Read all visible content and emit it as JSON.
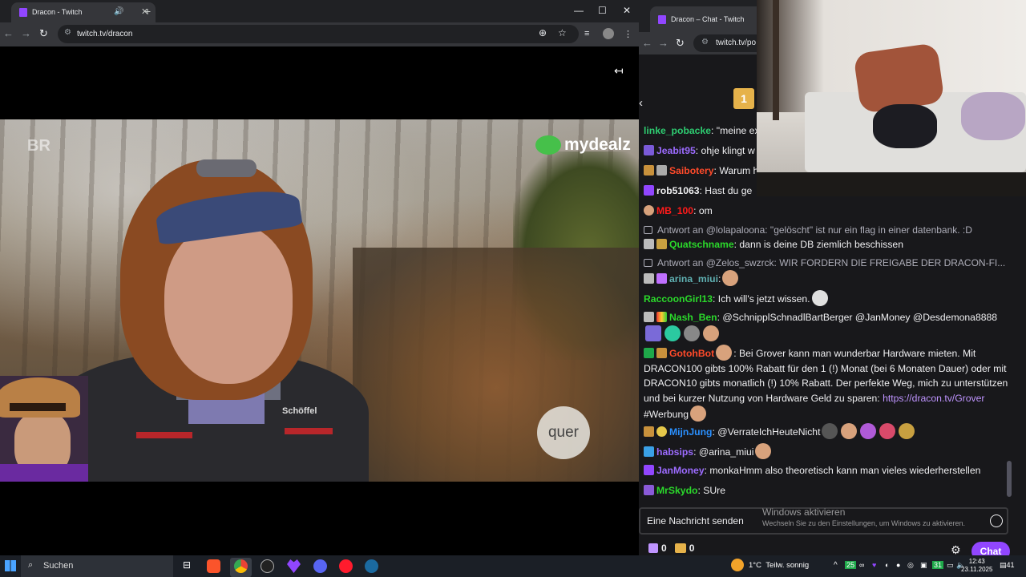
{
  "left_browser": {
    "tab_title": "Dracon - Twitch",
    "url": "twitch.tv/dracon",
    "new_tab": "+",
    "minimize": "—",
    "maximize": "☐",
    "close": "✕"
  },
  "video": {
    "br_logo": "BR",
    "sponsor_logo": "mydealz",
    "channel_logo": "quer",
    "jacket_brand": "Schöffel"
  },
  "right_browser": {
    "tab_title": "Dracon – Chat - Twitch",
    "url": "twitch.tv/po"
  },
  "chat": {
    "gift_count": "1",
    "messages": [
      {
        "user": "linke_pobacke",
        "color": "#00ff7f",
        "text": ": \"meine ex"
      },
      {
        "user": "Jeabit95",
        "color": "#9146ff",
        "text": ": ohje klingt w"
      },
      {
        "user": "Saibotery",
        "color": "#ff4500",
        "text": ": Warum h"
      },
      {
        "user": "rob51063",
        "color": "#efeff1",
        "text": ": Hast du ge"
      },
      {
        "user": "MB_100",
        "color": "#ff0000",
        "text": ": om"
      },
      {
        "reply": "Antwort an @lolapaloona: \"gelöscht\" ist nur ein flag in einer datenbank. :D"
      },
      {
        "user": "Quatschname",
        "color": "#00ff00",
        "text": ": dann is deine DB ziemlich beschissen"
      },
      {
        "reply": "Antwort an @Zelos_swzrck: WIR FORDERN DIE FREIGABE DER DRACON-FI..."
      },
      {
        "user": "arina_miui",
        "color": "#5f9ea0",
        "text": ":"
      },
      {
        "user": "RaccoonGirl13",
        "color": "#00ff00",
        "text": ": Ich will's jetzt wissen."
      },
      {
        "user": "Nash_Ben",
        "color": "#00ff00",
        "text": ": @SchnipplSchnadlBartBerger @JanMoney @Desdemona8888"
      },
      {
        "user": "GotohBot",
        "color": "#ff4500",
        "text": ": Bei Grover kann man wunderbar Hardware mieten. Mit DRACON100 gibts 100% Rabatt für den 1 (!) Monat (bei 6 Monaten Dauer) oder mit DRACON10 gibts monatlich (!) 10% Rabatt. Der perfekte Weg, mich zu unterstützen und bei kurzer Nutzung von Hardware Geld zu sparen:",
        "link": "https://dracon.tv/Grover",
        "tail": "#Werbung"
      },
      {
        "user": "MijnJung",
        "color": "#1e90ff",
        "text": ": @VerrateIchHeuteNicht"
      },
      {
        "user": "habsips",
        "color": "#9146ff",
        "text": ": @arina_miui"
      },
      {
        "user": "JanMoney",
        "color": "#9146ff",
        "text": ": monkaHmm also theoretisch kann man vieles wiederherstellen"
      },
      {
        "user": "MrSkydo",
        "color": "#00ff00",
        "text": ": SUre"
      }
    ],
    "input_placeholder": "Eine Nachricht senden",
    "points": "0",
    "bits": "0",
    "chat_button": "Chat",
    "win_activate_title": "Windows aktivieren",
    "win_activate_sub": "Wechseln Sie zu den Einstellungen, um Windows zu aktivieren."
  },
  "taskbar": {
    "search_label": "Suchen",
    "weather_temp": "1°C",
    "weather_text": "Teilw. sonnig",
    "time": "12:43",
    "date": "23.11.2025",
    "notif_count": "41",
    "tray_badge": "25",
    "calendar_day": "31"
  }
}
